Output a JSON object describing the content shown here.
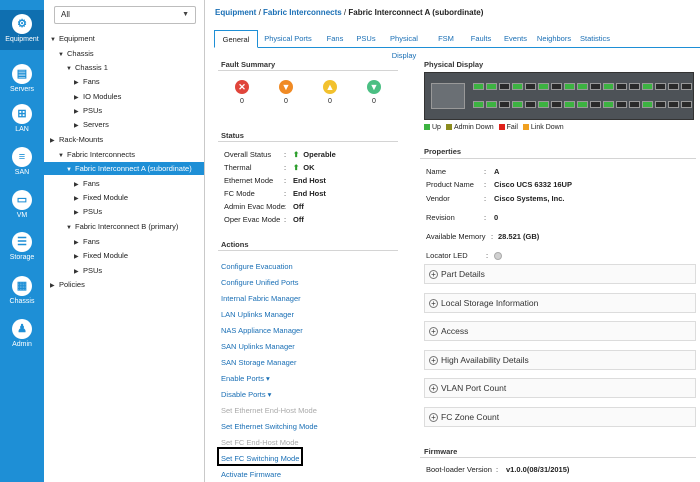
{
  "leftnav": [
    {
      "label": "Equipment",
      "icon": "equipment-icon",
      "glyph": "⚙"
    },
    {
      "label": "Servers",
      "icon": "servers-icon",
      "glyph": "▤"
    },
    {
      "label": "LAN",
      "icon": "lan-icon",
      "glyph": "⊞"
    },
    {
      "label": "SAN",
      "icon": "san-icon",
      "glyph": "≡"
    },
    {
      "label": "VM",
      "icon": "vm-icon",
      "glyph": "▭"
    },
    {
      "label": "Storage",
      "icon": "storage-icon",
      "glyph": "☰"
    },
    {
      "label": "Chassis",
      "icon": "chassis-icon",
      "glyph": "▦"
    },
    {
      "label": "Admin",
      "icon": "admin-icon",
      "glyph": "♟"
    }
  ],
  "filter": {
    "value": "All"
  },
  "tree": [
    {
      "label": "Equipment",
      "arrow": "▼"
    },
    {
      "label": "Chassis",
      "arrow": "▼"
    },
    {
      "label": "Chassis 1",
      "arrow": "▼"
    },
    {
      "label": "Fans",
      "arrow": "▶"
    },
    {
      "label": "IO Modules",
      "arrow": "▶"
    },
    {
      "label": "PSUs",
      "arrow": "▶"
    },
    {
      "label": "Servers",
      "arrow": "▶"
    },
    {
      "label": "Rack-Mounts",
      "arrow": "▶"
    },
    {
      "label": "Fabric Interconnects",
      "arrow": "▼"
    },
    {
      "label": "Fabric Interconnect A (subordinate)",
      "arrow": "▼"
    },
    {
      "label": "Fans",
      "arrow": "▶"
    },
    {
      "label": "Fixed Module",
      "arrow": "▶"
    },
    {
      "label": "PSUs",
      "arrow": "▶"
    },
    {
      "label": "Fabric Interconnect B (primary)",
      "arrow": "▼"
    },
    {
      "label": "Fans",
      "arrow": "▶"
    },
    {
      "label": "Fixed Module",
      "arrow": "▶"
    },
    {
      "label": "PSUs",
      "arrow": "▶"
    },
    {
      "label": "Policies",
      "arrow": "▶"
    }
  ],
  "breadcrumb": {
    "part1": "Equipment",
    "sep": " / ",
    "part2": "Fabric Interconnects",
    "current": "Fabric Interconnect A (subordinate)"
  },
  "tabs": [
    "General",
    "Physical Ports",
    "Fans",
    "PSUs",
    "Physical Display",
    "FSM",
    "Faults",
    "Events",
    "Neighbors",
    "Statistics"
  ],
  "fault_summary": {
    "title": "Fault Summary",
    "items": [
      {
        "icon": "critical-icon",
        "glyph": "✕",
        "color": "#e0453b",
        "count": "0"
      },
      {
        "icon": "major-icon",
        "glyph": "▼",
        "color": "#f08a24",
        "count": "0"
      },
      {
        "icon": "minor-icon",
        "glyph": "▲",
        "color": "#f2c12e",
        "count": "0"
      },
      {
        "icon": "warning-icon",
        "glyph": "▼",
        "color": "#4bbf83",
        "count": "0"
      }
    ]
  },
  "status": {
    "title": "Status",
    "rows": [
      {
        "label": "Overall Status",
        "value": "Operable",
        "ok": true
      },
      {
        "label": "Thermal",
        "value": "OK",
        "ok": true
      },
      {
        "label": "Ethernet Mode",
        "value": "End Host"
      },
      {
        "label": "FC Mode",
        "value": "End Host"
      },
      {
        "label": "Admin Evac Mode",
        "value": "Off"
      },
      {
        "label": "Oper Evac Mode",
        "value": "Off"
      }
    ]
  },
  "actions": {
    "title": "Actions",
    "items": [
      {
        "label": "Configure Evacuation"
      },
      {
        "label": "Configure Unified Ports"
      },
      {
        "label": "Internal Fabric Manager"
      },
      {
        "label": "LAN Uplinks Manager"
      },
      {
        "label": "NAS Appliance Manager"
      },
      {
        "label": "SAN Uplinks Manager"
      },
      {
        "label": "SAN Storage Manager"
      },
      {
        "label": "Enable Ports ▾"
      },
      {
        "label": "Disable Ports ▾"
      },
      {
        "label": "Set Ethernet End-Host Mode",
        "disabled": true
      },
      {
        "label": "Set Ethernet Switching Mode"
      },
      {
        "label": "Set FC End-Host Mode",
        "disabled": true
      },
      {
        "label": "Set FC Switching Mode"
      },
      {
        "label": "Activate Firmware"
      }
    ]
  },
  "physical_display": {
    "title": "Physical Display",
    "legend": [
      {
        "label": "Up",
        "color": "#3cb341"
      },
      {
        "label": "Admin Down",
        "color": "#8c8c1e"
      },
      {
        "label": "Fail",
        "color": "#e0211b"
      },
      {
        "label": "Link Down",
        "color": "#f0a020"
      }
    ]
  },
  "properties": {
    "title": "Properties",
    "rows": [
      {
        "label": "Name",
        "value": "A"
      },
      {
        "label": "Product Name",
        "value": "Cisco UCS 6332 16UP"
      },
      {
        "label": "Vendor",
        "value": "Cisco Systems, Inc."
      },
      {
        "label": "Revision",
        "value": "0"
      },
      {
        "label": "Available Memory",
        "value": "28.521 (GB)"
      }
    ],
    "locator_led_label": "Locator LED"
  },
  "accordions": [
    "Part Details",
    "Local Storage Information",
    "Access",
    "High Availability Details",
    "VLAN Port Count",
    "FC Zone Count"
  ],
  "firmware": {
    "title": "Firmware",
    "bootloader_label": "Boot-loader Version",
    "bootloader_value": "v1.0.0(08/31/2015)"
  }
}
